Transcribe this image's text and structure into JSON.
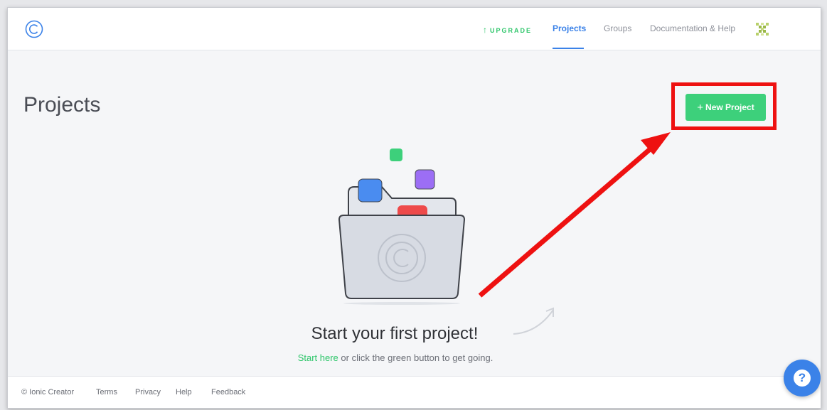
{
  "header": {
    "logo_icon": "ionic-creator-logo",
    "upgrade_arrow": "↑",
    "upgrade_label": "UPGRADE",
    "nav": {
      "projects": "Projects",
      "groups": "Groups",
      "docs": "Documentation & Help"
    },
    "avatar_icon": "identicon-avatar"
  },
  "main": {
    "title": "Projects",
    "new_project_plus": "+",
    "new_project_label": "New Project",
    "empty_title": "Start your first project!",
    "empty_link": "Start here",
    "empty_rest": " or click the green button to get going."
  },
  "footer": {
    "copyright": "© Ionic Creator",
    "terms": "Terms",
    "privacy": "Privacy",
    "help": "Help",
    "feedback": "Feedback"
  },
  "help_fab": {
    "label": "?"
  },
  "colors": {
    "accent_blue": "#3b82e8",
    "accent_green": "#3dd07b",
    "annotation_red": "#ee1111"
  }
}
